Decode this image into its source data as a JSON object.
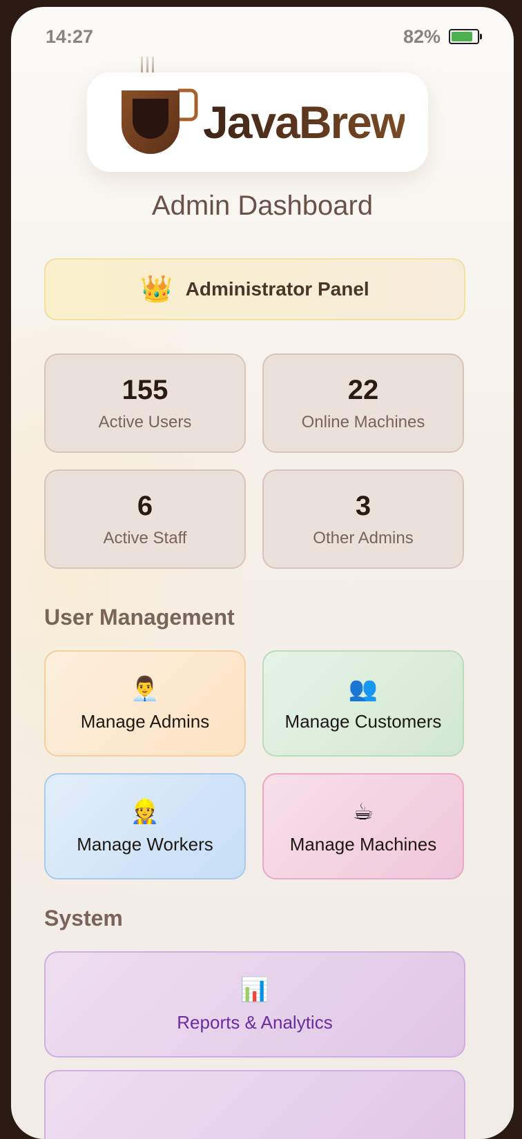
{
  "status_bar": {
    "time": "14:27",
    "battery_percent": "82%",
    "battery_level": 0.82,
    "battery_color": "#4caf50"
  },
  "brand": {
    "name": "JavaBrew",
    "logo_icon": "coffee-cup-icon"
  },
  "page": {
    "title": "Admin Dashboard"
  },
  "admin_banner": {
    "icon": "crown-icon",
    "emoji": "👑",
    "label": "Administrator Panel"
  },
  "stats": [
    {
      "value": "155",
      "label": "Active Users"
    },
    {
      "value": "22",
      "label": "Online Machines"
    },
    {
      "value": "6",
      "label": "Active Staff"
    },
    {
      "value": "3",
      "label": "Other Admins"
    }
  ],
  "sections": {
    "user_management": "User Management",
    "system": "System"
  },
  "user_management": [
    {
      "icon": "office-worker-icon",
      "emoji": "👨‍💼",
      "label": "Manage Admins",
      "color": "#fbe2c2"
    },
    {
      "icon": "people-icon",
      "emoji": "👥",
      "label": "Manage Customers",
      "color": "#d2e8d2"
    },
    {
      "icon": "construction-worker-icon",
      "emoji": "👷",
      "label": "Manage Workers",
      "color": "#c6def6"
    },
    {
      "icon": "hot-beverage-icon",
      "emoji": "☕",
      "label": "Manage Machines",
      "color": "#f0c6da"
    }
  ],
  "system": [
    {
      "icon": "bar-chart-icon",
      "emoji": "📊",
      "label": "Reports & Analytics",
      "color": "#dfc6e6"
    }
  ]
}
